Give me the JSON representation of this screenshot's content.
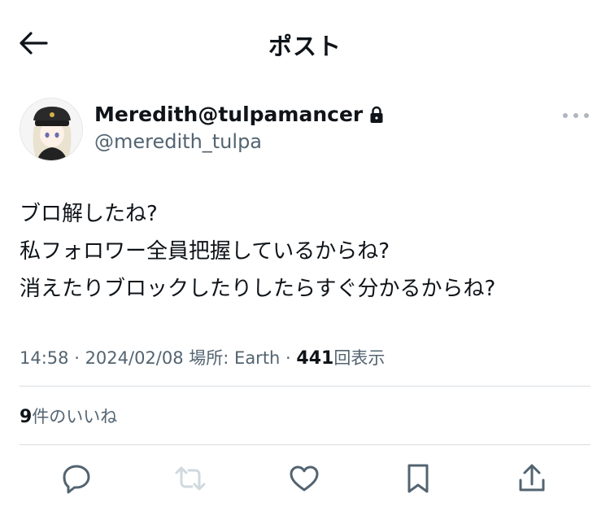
{
  "header": {
    "title": "ポスト",
    "back_icon": "arrow-left-icon"
  },
  "author": {
    "display_name": "Meredith@tulpamancer",
    "handle": "@meredith_tulpa",
    "protected_icon": "lock-icon",
    "avatar_icon": "avatar-illustration",
    "more_icon": "more-horizontal-icon"
  },
  "tweet": {
    "lines": [
      "ブロ解したね?",
      "私フォロワー全員把握しているからね?",
      "消えたりブロックしたりしたらすぐ分かるからね?"
    ]
  },
  "meta": {
    "time": "14:58",
    "sep1": " · ",
    "date": "2024/02/08",
    "location": "場所: Earth",
    "sep2": " · ",
    "views_count": "441",
    "views_label": "回表示"
  },
  "likes": {
    "count": "9",
    "label": "件のいいね"
  },
  "actions": {
    "reply_icon": "reply-icon",
    "retweet_icon": "retweet-icon",
    "like_icon": "heart-icon",
    "bookmark_icon": "bookmark-icon",
    "share_icon": "share-icon",
    "retweet_disabled_color": "#cfd9de"
  }
}
